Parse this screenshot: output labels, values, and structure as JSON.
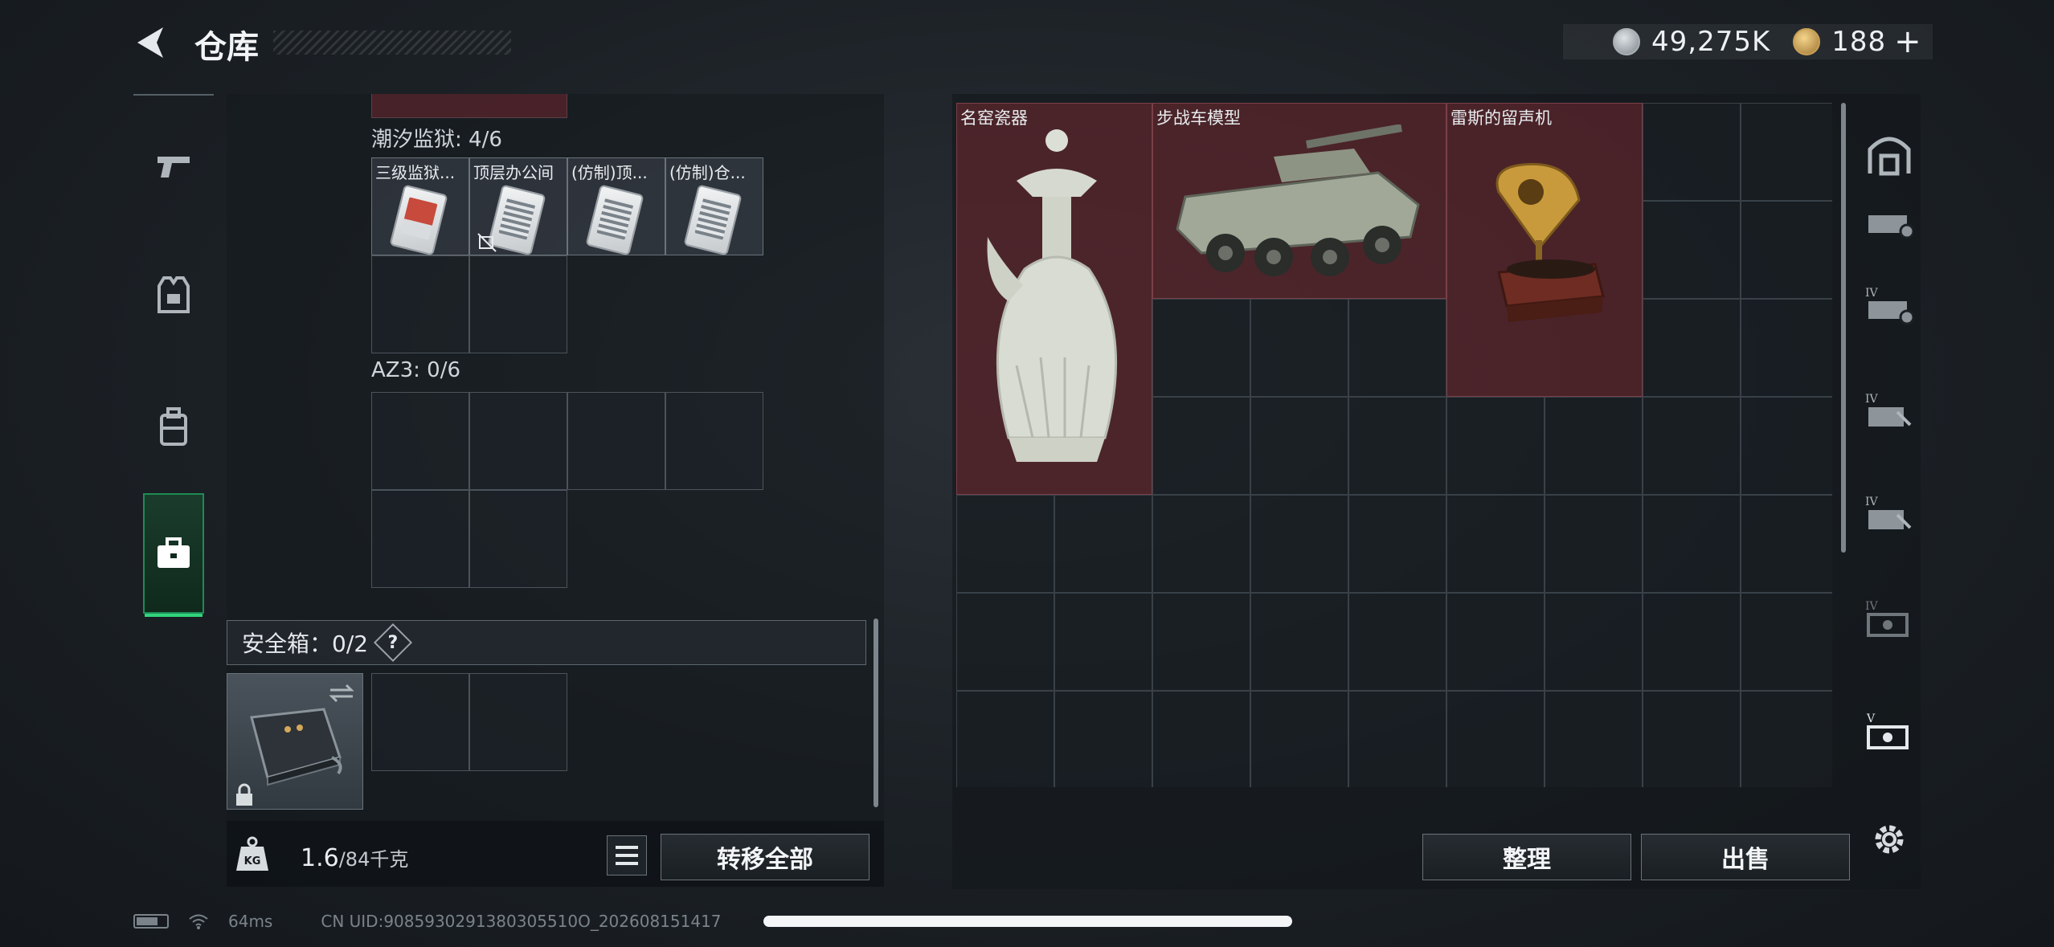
{
  "header": {
    "title": "仓库",
    "currencies": [
      {
        "icon": "silver-coin-icon",
        "value": "49,275K"
      },
      {
        "icon": "gold-coin-icon",
        "value": "188"
      }
    ],
    "add_label": "+"
  },
  "left_nav": [
    "pistol-icon",
    "armor-vest-icon",
    "backpack-icon",
    "toolbox-icon"
  ],
  "left_panel": {
    "sections": [
      {
        "label": "潮汐监狱: 4/6",
        "items": [
          "三级监狱...",
          "顶层办公间",
          "(仿制)顶...",
          "(仿制)仓..."
        ]
      },
      {
        "label": "AZ3: 0/6",
        "items": []
      }
    ],
    "safe_box": {
      "label": "安全箱：0/2",
      "help": "?"
    },
    "weight": {
      "current": "1.6",
      "max": "/84千克"
    },
    "transfer_all": "转移全部"
  },
  "storage": {
    "items": [
      {
        "name": "名窑瓷器",
        "icon": "porcelain-vase-icon"
      },
      {
        "name": "步战车模型",
        "icon": "armored-vehicle-model-icon"
      },
      {
        "name": "雷斯的留声机",
        "icon": "gramophone-icon"
      }
    ],
    "sort_button": "整理",
    "sell_button": "出售"
  },
  "right_nav": [
    "vault-icon",
    "container-tier-icon",
    "container-tier-iv-icon",
    "case-tier-iv-icon",
    "case-tier-iv-icon",
    "chest-tier-iv-icon",
    "chest-tier-v-icon",
    "settings-gear-icon"
  ],
  "status_bar": {
    "ping": "64ms",
    "uid": "CN UID:9085930291380305510O_202608151417"
  },
  "colors": {
    "accent_green": "#31d47c",
    "item_red": "#742a32",
    "background": "#1b2025"
  }
}
